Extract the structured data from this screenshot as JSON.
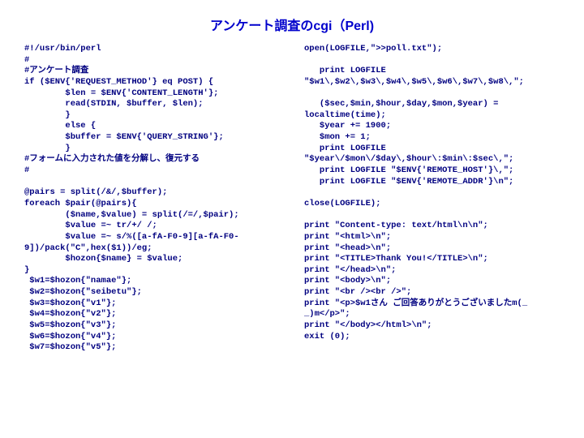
{
  "title": "アンケート調査のcgi（Perl)",
  "code_left": "#!/usr/bin/perl\n#\n#アンケート調査\nif ($ENV{'REQUEST_METHOD'} eq POST) {\n        $len = $ENV{'CONTENT_LENGTH'};\n        read(STDIN, $buffer, $len);\n        }\n        else {\n        $buffer = $ENV{'QUERY_STRING'};\n        }\n#フォームに入力された値を分解し、復元する\n#\n\n@pairs = split(/&/,$buffer);\nforeach $pair(@pairs){\n        ($name,$value) = split(/=/,$pair);\n        $value =~ tr/+/ /;\n        $value =~ s/%([a-fA-F0-9][a-fA-F0-\n9])/pack(\"C\",hex($1))/eg;\n        $hozon{$name} = $value;\n}\n $w1=$hozon{\"namae\"};\n $w2=$hozon{\"seibetu\"};\n $w3=$hozon{\"v1\"};\n $w4=$hozon{\"v2\"};\n $w5=$hozon{\"v3\"};\n $w6=$hozon{\"v4\"};\n $w7=$hozon{\"v5\"};",
  "code_right": "open(LOGFILE,\">>poll.txt\");\n\n   print LOGFILE\n\"$w1\\,$w2\\,$w3\\,$w4\\,$w5\\,$w6\\,$w7\\,$w8\\,\";\n\n   ($sec,$min,$hour,$day,$mon,$year) =\nlocaltime(time);\n   $year += 1900;\n   $mon += 1;\n   print LOGFILE\n\"$year\\/$mon\\/$day\\,$hour\\:$min\\:$sec\\,\";\n   print LOGFILE \"$ENV{'REMOTE_HOST'}\\,\";\n   print LOGFILE \"$ENV{'REMOTE_ADDR'}\\n\";\n\nclose(LOGFILE);\n\nprint \"Content-type: text/html\\n\\n\";\nprint \"<html>\\n\";\nprint \"<head>\\n\";\nprint \"<TITLE>Thank You!</TITLE>\\n\";\nprint \"</head>\\n\";\nprint \"<body>\\n\";\nprint \"<br /><br />\";\nprint \"<p>$w1さん ご回答ありがとうございましたm(_\n_)m</p>\";\nprint \"</body></html>\\n\";\nexit (0);"
}
